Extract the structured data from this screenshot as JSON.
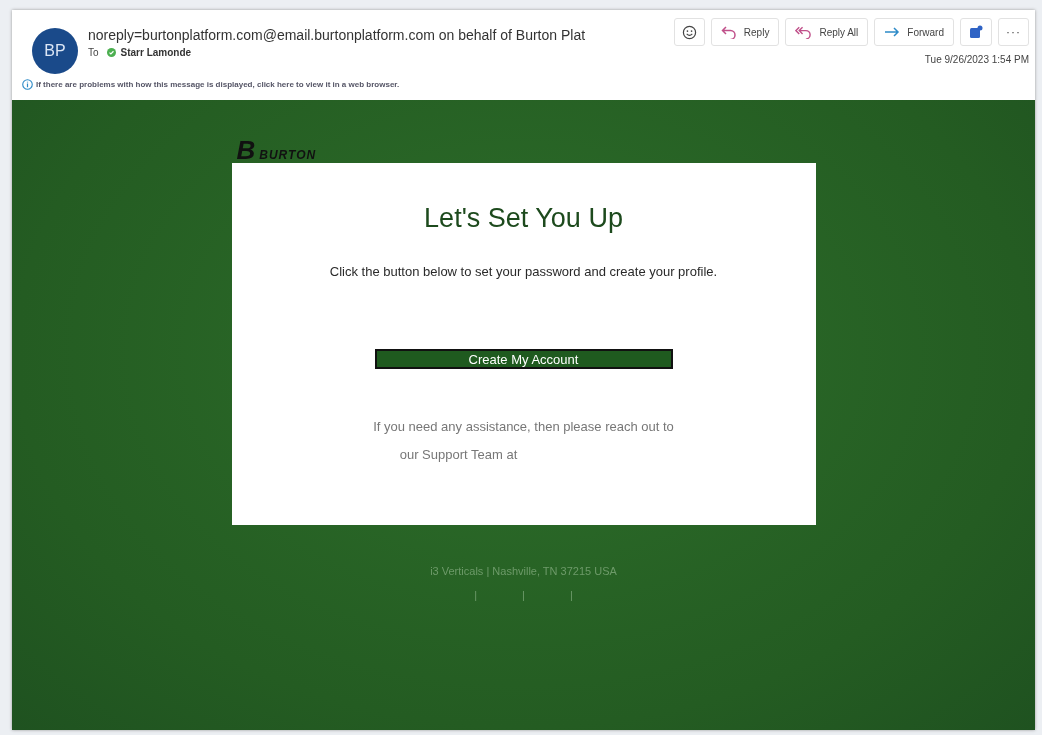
{
  "header": {
    "avatar_initials": "BP",
    "sender": "noreply=burtonplatform.com@email.burtonplatform.com on behalf of Burton Plat",
    "to_label": "To",
    "recipient": "Starr Lamonde",
    "info_bar": "If there are problems with how this message is displayed, click here to view it in a web browser.",
    "date": "Tue 9/26/2023 1:54 PM"
  },
  "toolbar": [
    {
      "kind": "emoji"
    },
    {
      "kind": "reply",
      "label": "Reply"
    },
    {
      "kind": "reply_all",
      "label": "Reply All"
    },
    {
      "kind": "forward",
      "label": "Forward"
    },
    {
      "kind": "teams"
    },
    {
      "kind": "more",
      "label": "···"
    }
  ],
  "email": {
    "logo_mark": "B",
    "logo_text": "BURTON",
    "title": "Let's Set You Up",
    "intro": "Click the button below to set your password and create your profile.",
    "button": "Create My Account",
    "assistance_lines": [
      "If you need any assistance, then please reach out to",
      "our Support Team at"
    ],
    "footer_address": "i3 Verticals | Nashville, TN 37215 USA",
    "footer_separators": [
      "|",
      "|",
      "|"
    ]
  }
}
